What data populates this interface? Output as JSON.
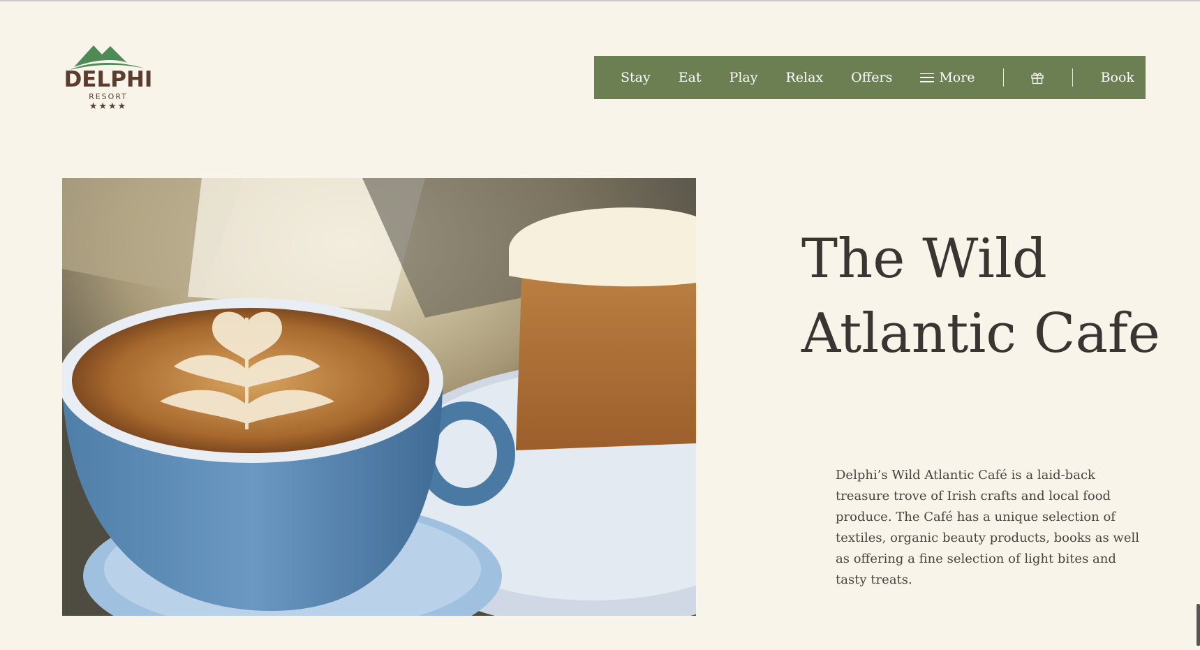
{
  "logo": {
    "name": "DELPHI",
    "sub": "RESORT",
    "stars": "★★★★",
    "colors": {
      "mountain": "#4e8a55",
      "text": "#5a3d2e"
    }
  },
  "nav": {
    "items": [
      {
        "label": "Stay"
      },
      {
        "label": "Eat"
      },
      {
        "label": "Play"
      },
      {
        "label": "Relax"
      },
      {
        "label": "Offers"
      }
    ],
    "more_label": "More",
    "gift_icon": "gift-icon",
    "book_label": "Book",
    "background": "#6b7f52"
  },
  "hero": {
    "image": "latte-and-cake-photo"
  },
  "content": {
    "title": "The Wild Atlantic Cafe",
    "description": "Delphi’s Wild Atlantic Café is a laid-back treasure trove of Irish crafts and local food produce. The Café has a unique selection of textiles, organic beauty products, books as well as offering a fine selection of light bites and tasty treats."
  },
  "colors": {
    "page_background": "#f9f4ea",
    "title_text": "#3a3432"
  }
}
